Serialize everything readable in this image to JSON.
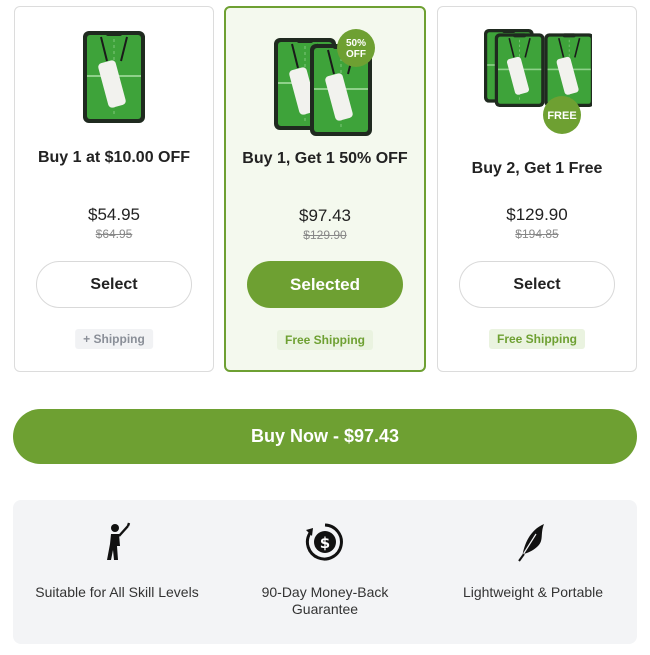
{
  "offers": [
    {
      "title": "Buy 1 at $10.00 OFF",
      "price": "$54.95",
      "old_price": "$64.95",
      "button_label": "Select",
      "shipping": "+ Shipping",
      "selected": false
    },
    {
      "title": "Buy 1, Get 1 50% OFF",
      "badge": "50% OFF",
      "price": "$97.43",
      "old_price": "$129.90",
      "button_label": "Selected",
      "shipping": "Free Shipping",
      "selected": true
    },
    {
      "title": "Buy 2, Get 1 Free",
      "badge": "FREE",
      "price": "$129.90",
      "old_price": "$194.85",
      "button_label": "Select",
      "shipping": "Free Shipping",
      "selected": false
    }
  ],
  "buy_now_label": "Buy Now - $97.43",
  "features": [
    {
      "icon": "golfer-icon",
      "label": "Suitable for All Skill Levels"
    },
    {
      "icon": "money-back-icon",
      "label": "90-Day Money-Back Guarantee"
    },
    {
      "icon": "feather-icon",
      "label": "Lightweight & Portable"
    }
  ],
  "colors": {
    "accent": "#6ea032",
    "selected_bg": "#f4f9ee",
    "free_ship_bg": "#eaf3e0",
    "paid_ship_bg": "#f1f2f4",
    "features_bg": "#f3f4f6"
  }
}
